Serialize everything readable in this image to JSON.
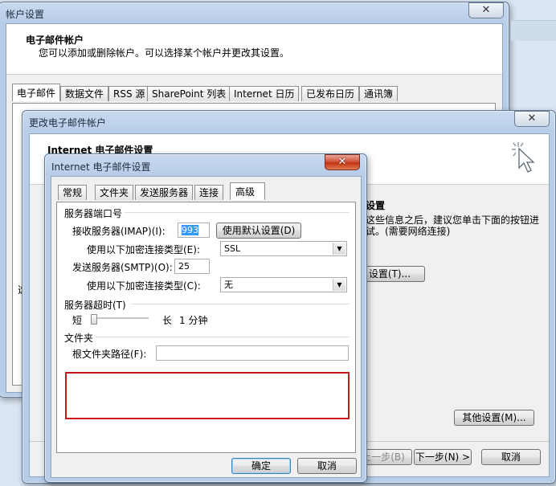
{
  "back_window": {
    "title": "帐户设置",
    "close_glyph": "✕",
    "heading": "电子邮件帐户",
    "description": "您可以添加或删除帐户。可以选择某个帐户并更改其设置。",
    "tabs": [
      "电子邮件",
      "数据文件",
      "RSS 源",
      "SharePoint 列表",
      "Internet 日历",
      "已发布日历",
      "通讯簿"
    ],
    "partial_left_label": "选"
  },
  "mid_window": {
    "title": "更改电子邮件帐户",
    "close_glyph": "✕",
    "heading": "Internet 电子邮件设置",
    "right_heading": "设置",
    "right_text_line1": "这些信息之后，建议您单击下面的按钮进",
    "right_text_line2": "试。(需要网络连接)",
    "test_button_partial": "设置(T)...",
    "other_settings_button": "其他设置(M)...",
    "back_button_partial": "上一步(B)",
    "next_button": "下一步(N) >",
    "cancel_button": "取消"
  },
  "dialog": {
    "title": "Internet 电子邮件设置",
    "close_glyph": "✕",
    "tabs": [
      "常规",
      "文件夹",
      "发送服务器",
      "连接",
      "高级"
    ],
    "active_tab": "高级",
    "ports_group": "服务器端口号",
    "imap_label": "接收服务器(IMAP)(I):",
    "imap_value": "993",
    "use_default_button": "使用默认设置(D)",
    "enc_label_in": "使用以下加密连接类型(E):",
    "enc_value_in": "SSL",
    "smtp_label": "发送服务器(SMTP)(O):",
    "smtp_value": "25",
    "enc_label_out": "使用以下加密连接类型(C):",
    "enc_value_out": "无",
    "timeout_group": "服务器超时(T)",
    "timeout_short": "短",
    "timeout_long": "长",
    "timeout_value": "1 分钟",
    "timeout_level": 0.0,
    "folder_group": "文件夹",
    "root_path_label": "根文件夹路径(F):",
    "root_path_value": "",
    "ok_button": "确定",
    "cancel_button": "取消",
    "highlight_color": "#c8161d"
  }
}
